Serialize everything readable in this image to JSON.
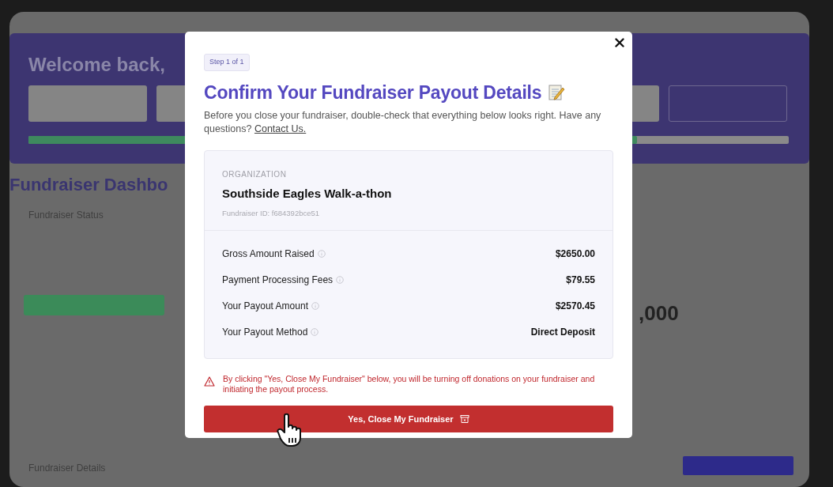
{
  "background": {
    "welcome": "Welcome back,",
    "onboarding_progress": {
      "level": 0.8
    },
    "dashboard_title": "Fundraiser Dashbo",
    "status_card_title": "Fundraiser Status",
    "goal_amount": ",000",
    "details_card_title": "Fundraiser Details"
  },
  "modal": {
    "step_badge": "Step 1 of 1",
    "title": "Confirm Your Fundraiser Payout Details",
    "intro": "Before you close your fundraiser, double-check that everything below looks right. Have any questions?",
    "contact_link": "Contact Us.",
    "organization": {
      "label": "ORGANIZATION",
      "name": "Southside Eagles Walk-a-thon",
      "fundraiser_id": "Fundraiser ID: f684392bce51"
    },
    "rows": [
      {
        "label": "Gross Amount Raised",
        "value": "$2650.00"
      },
      {
        "label": "Payment Processing Fees",
        "value": "$79.55"
      },
      {
        "label": "Your Payout Amount",
        "value": "$2570.45"
      },
      {
        "label": "Your Payout Method",
        "value": "Direct Deposit"
      }
    ],
    "warning": "By clicking \"Yes, Close My Fundraiser\" below, you will be turning off donations on your fundraiser and initiating the payout process.",
    "confirm_button": "Yes, Close My Fundraiser"
  }
}
